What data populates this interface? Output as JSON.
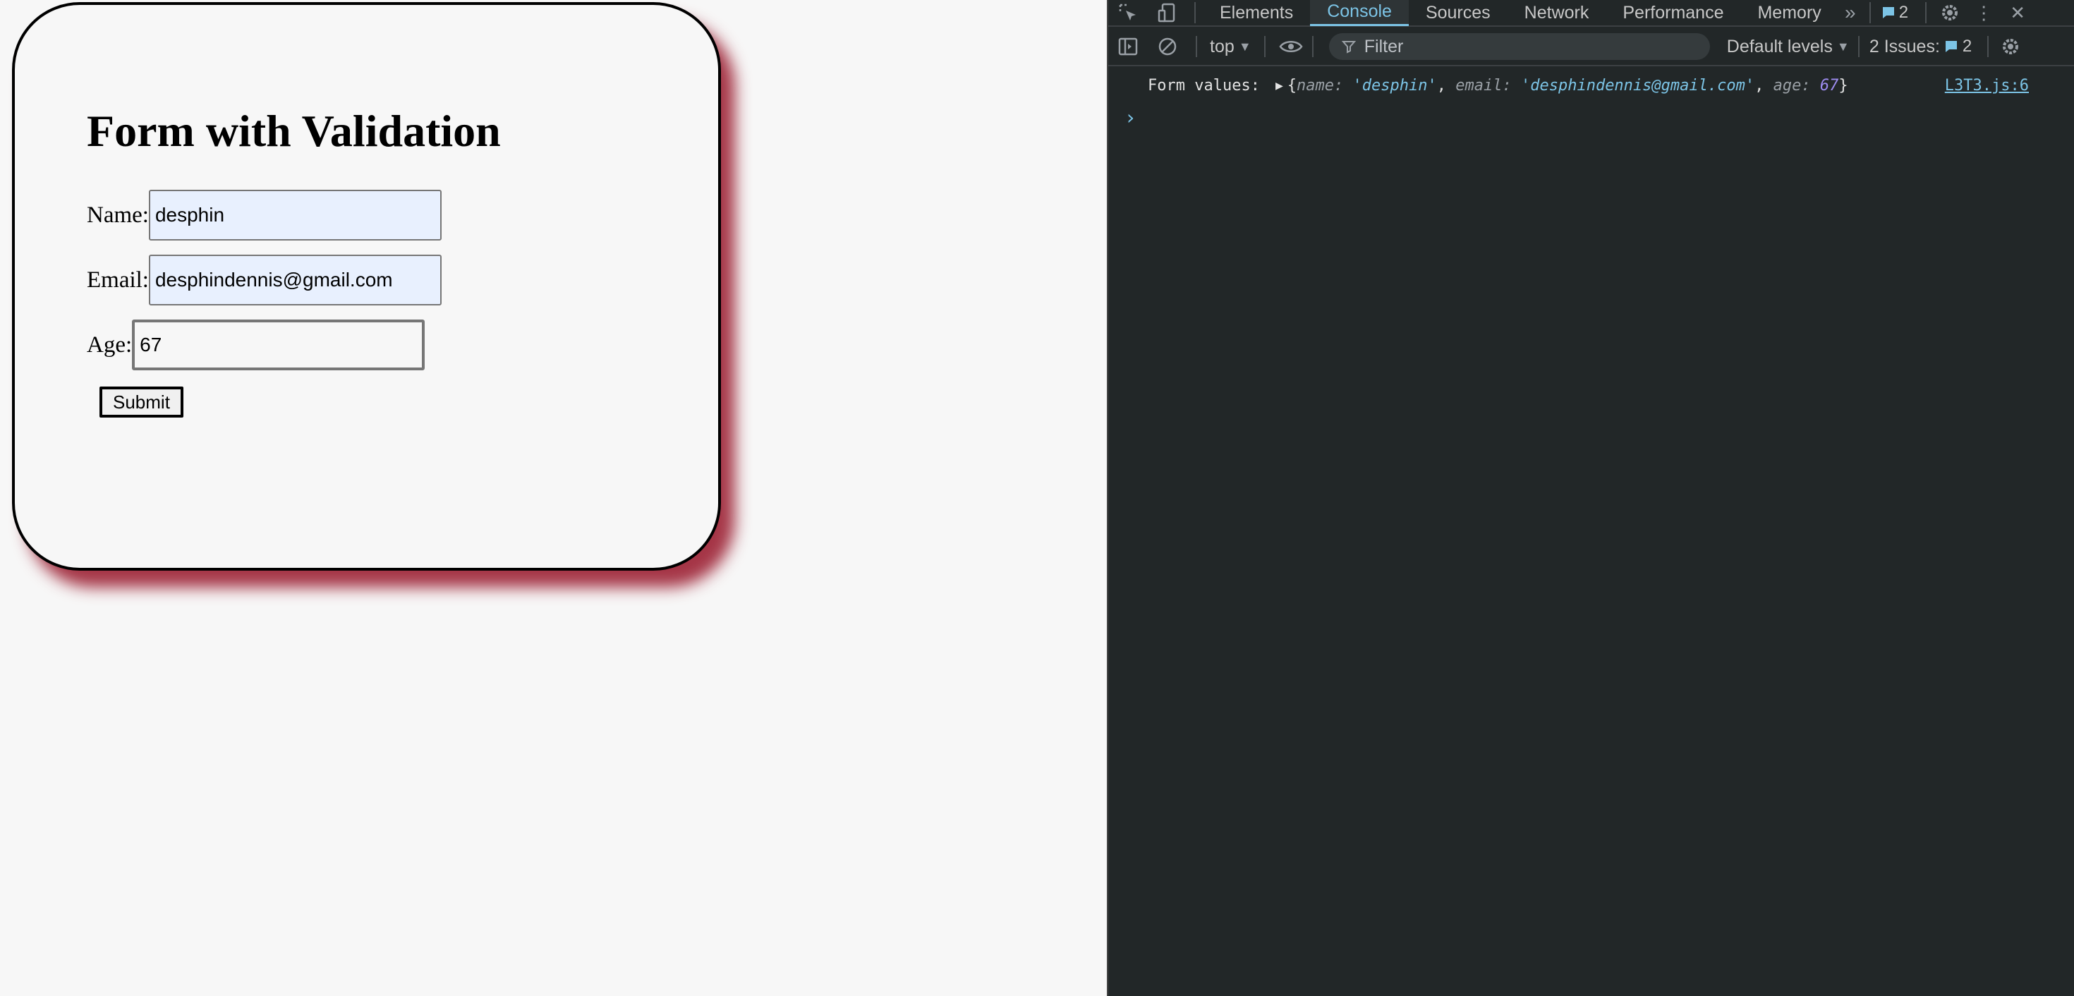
{
  "form": {
    "title": "Form with Validation",
    "name_label": "Name:",
    "name_value": "desphin",
    "email_label": "Email:",
    "email_value": "desphindennis@gmail.com",
    "age_label": "Age:",
    "age_value": "67",
    "submit_label": "Submit"
  },
  "devtools": {
    "tabs": [
      "Elements",
      "Console",
      "Sources",
      "Network",
      "Performance",
      "Memory"
    ],
    "active_tab": "Console",
    "messages_badge": "2",
    "context": "top",
    "filter_placeholder": "Filter",
    "levels": "Default levels",
    "issues_label": "2 Issues:",
    "issues_count": "2",
    "console": {
      "prefix": "Form values:",
      "key_name": "name",
      "val_name": "'desphin'",
      "key_email": "email",
      "val_email": "'desphindennis@gmail.com'",
      "key_age": "age",
      "val_age": "67",
      "source_link": "L3T3.js:6"
    },
    "prompt": "›"
  },
  "colors": {
    "accent": "#7cc4e6",
    "devtools_bg": "#222728",
    "card_shadow": "#96142a",
    "autofill_bg": "#e8f0fe"
  }
}
